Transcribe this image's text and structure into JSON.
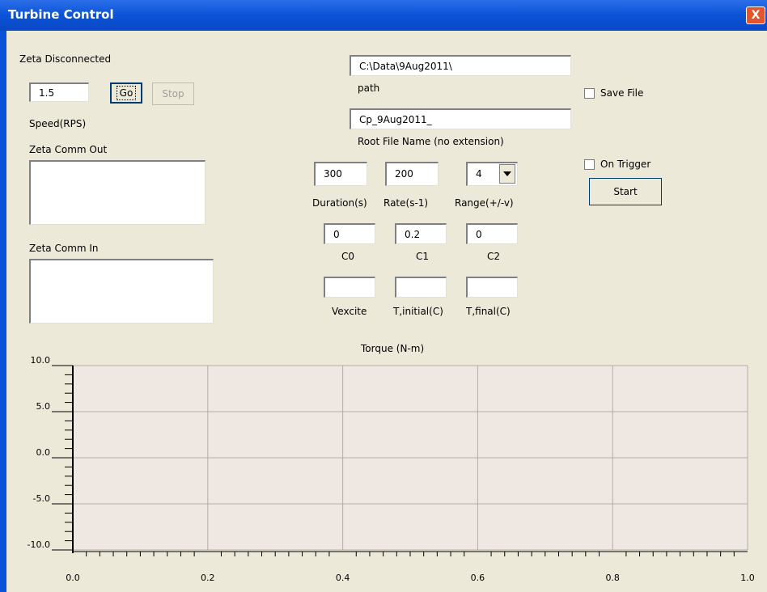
{
  "window": {
    "title": "Turbine Control",
    "close_glyph": "X"
  },
  "status": {
    "zeta": "Zeta Disconnected"
  },
  "speed": {
    "value": "1.5",
    "label": "Speed(RPS)",
    "go_label": "Go",
    "stop_label": "Stop"
  },
  "comm": {
    "out_label": "Zeta Comm Out",
    "in_label": "Zeta Comm In",
    "out_value": "",
    "in_value": ""
  },
  "file": {
    "path_value": "C:\\Data\\9Aug2011\\",
    "path_label": "path",
    "root_value": "Cp_9Aug2011_",
    "root_label": "Root File Name (no extension)",
    "save_label": "Save File",
    "save_checked": false
  },
  "acquisition": {
    "duration_value": "300",
    "duration_label": "Duration(s)",
    "rate_value": "200",
    "rate_label": "Rate(s-1)",
    "range_value": "4",
    "range_label": "Range(+/-v)",
    "trigger_label": "On Trigger",
    "trigger_checked": false,
    "start_label": "Start"
  },
  "coeffs": {
    "c0_value": "0",
    "c0_label": "C0",
    "c1_value": "0.2",
    "c1_label": "C1",
    "c2_value": "0",
    "c2_label": "C2"
  },
  "excite": {
    "vexcite_value": "",
    "vexcite_label": "Vexcite",
    "tinit_value": "",
    "tinit_label": "T,initial(C)",
    "tfinal_value": "",
    "tfinal_label": "T,final(C)"
  },
  "chart_data": {
    "type": "line",
    "title": "Torque (N-m)",
    "xlabel": "",
    "ylabel": "",
    "xlim": [
      0.0,
      1.0
    ],
    "ylim": [
      -10.0,
      10.0
    ],
    "xticks": [
      "0.0",
      "0.2",
      "0.4",
      "0.6",
      "0.8",
      "1.0"
    ],
    "yticks": [
      "10.0",
      "5.0",
      "0.0",
      "-5.0",
      "-10.0"
    ],
    "grid": true,
    "series": [],
    "colors": {
      "plot_bg": "#efe7e1",
      "grid": "#b4aca6",
      "axis": "#000000",
      "xtick": "#e00000"
    }
  }
}
